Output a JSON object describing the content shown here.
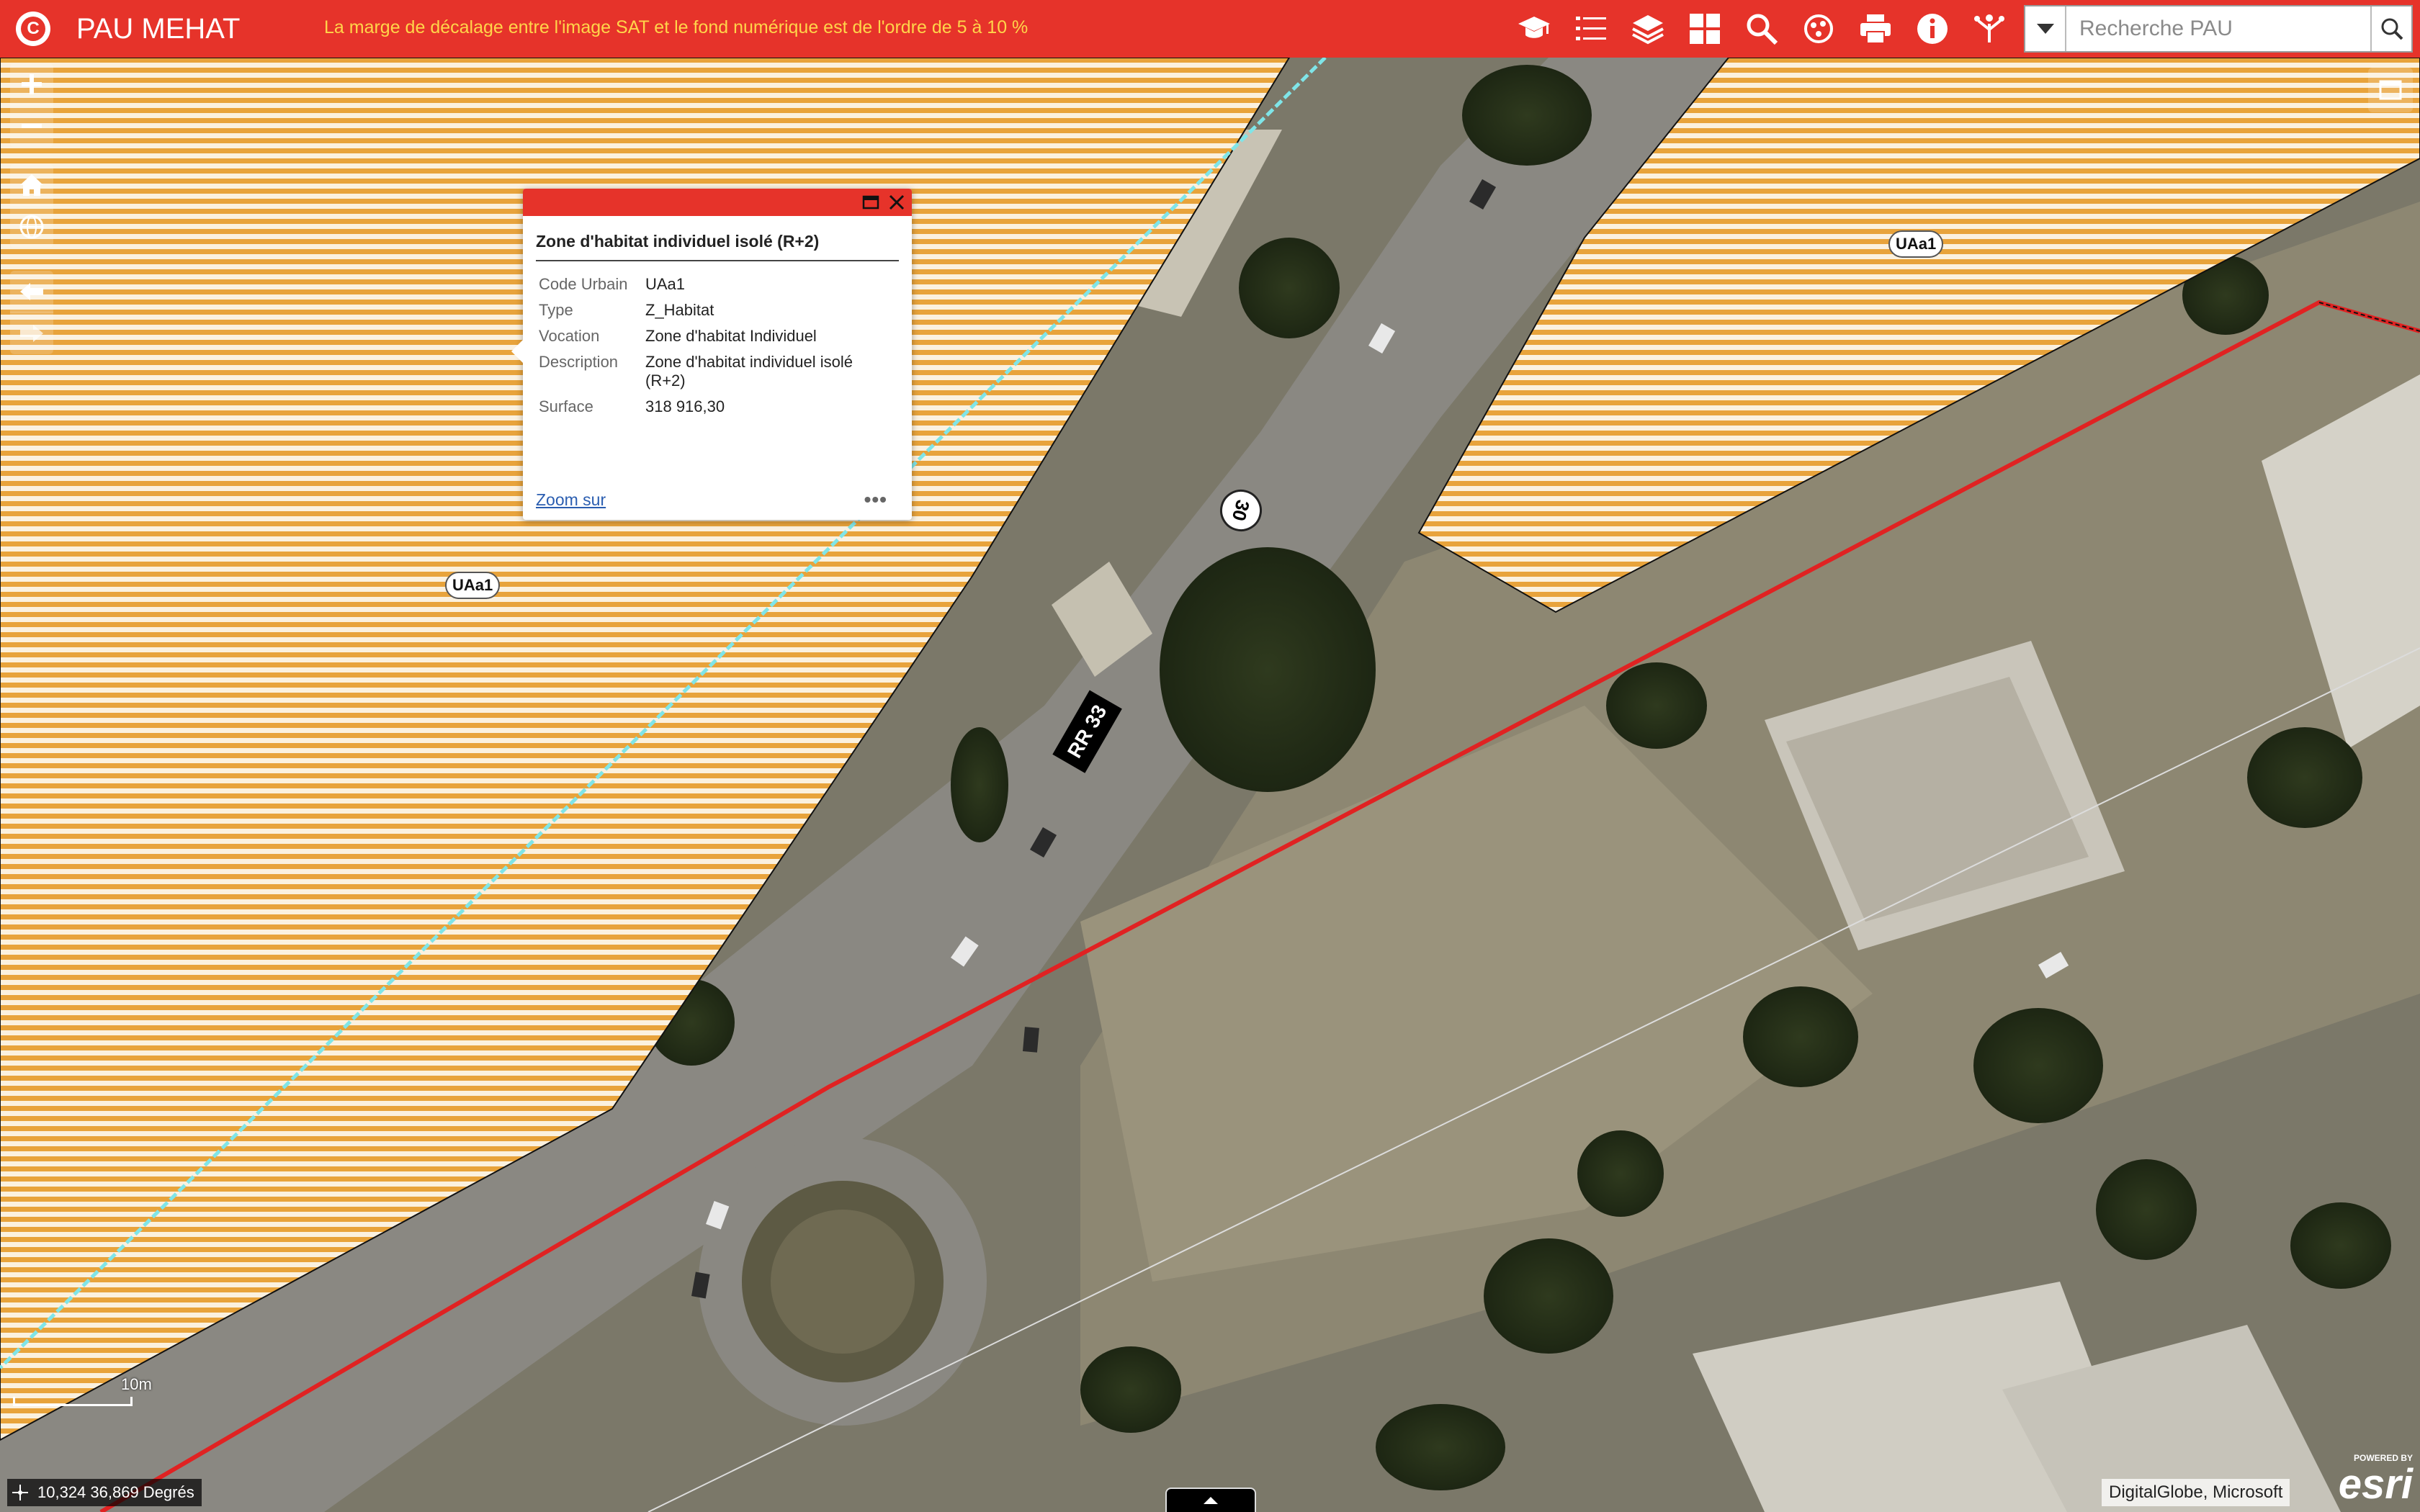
{
  "header": {
    "app_title": "PAU MEHAT",
    "message": "La marge de décalage entre l'image SAT et le fond numérique est de l'ordre de 5 à 10 %",
    "tools": [
      {
        "name": "graduation-cap-icon"
      },
      {
        "name": "legend-list-icon"
      },
      {
        "name": "layers-icon"
      },
      {
        "name": "basemap-gallery-icon"
      },
      {
        "name": "query-search-icon"
      },
      {
        "name": "analysis-icon"
      },
      {
        "name": "print-icon"
      },
      {
        "name": "info-icon"
      },
      {
        "name": "share-icon"
      }
    ],
    "search": {
      "placeholder": "Recherche PAU"
    }
  },
  "map": {
    "zone_labels": [
      "UAa1",
      "UAa1"
    ],
    "speed_limit": "30",
    "road_label": "RR 33",
    "scale": "10m",
    "coordinates": "10,324 36,869 Degrés",
    "attribution": "DigitalGlobe, Microsoft",
    "esri": {
      "powered": "POWERED BY",
      "word": "esri"
    }
  },
  "popup": {
    "title": "Zone d'habitat individuel isolé (R+2)",
    "rows": [
      {
        "key": "Code Urbain",
        "value": "UAa1"
      },
      {
        "key": "Type",
        "value": "Z_Habitat"
      },
      {
        "key": "Vocation",
        "value": "Zone d'habitat Individuel"
      },
      {
        "key": "Description",
        "value": "Zone d'habitat individuel isolé (R+2)"
      },
      {
        "key": "Surface",
        "value": "318 916,30"
      }
    ],
    "zoom_label": "Zoom sur",
    "more_label": "•••"
  },
  "colors": {
    "header": "#e6332a",
    "message": "#ffd54a",
    "zone_stripe": "#e8a33b",
    "boundary_red": "#e02222",
    "cyan_line": "#7fe5e8"
  }
}
